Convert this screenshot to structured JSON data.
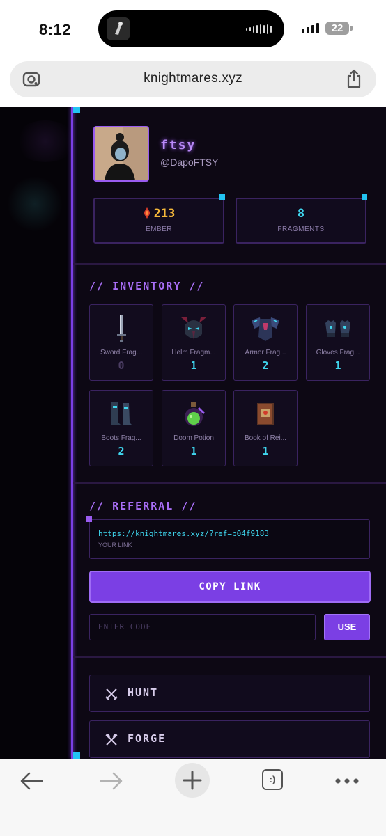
{
  "status_bar": {
    "time": "8:12",
    "battery": "22"
  },
  "browser": {
    "url": "knightmares.xyz"
  },
  "profile": {
    "username": "ftsy",
    "handle": "@DapoFTSY",
    "stats": [
      {
        "value": "213",
        "label": "EMBER",
        "color": "#f5b83a"
      },
      {
        "value": "8",
        "label": "FRAGMENTS",
        "color": "#3fd6ee"
      }
    ]
  },
  "inventory": {
    "title": "// INVENTORY //",
    "items": [
      {
        "name": "Sword Frag...",
        "count": "0",
        "icon": "sword-icon"
      },
      {
        "name": "Helm Fragm...",
        "count": "1",
        "icon": "helm-icon"
      },
      {
        "name": "Armor Frag...",
        "count": "2",
        "icon": "armor-icon"
      },
      {
        "name": "Gloves Frag...",
        "count": "1",
        "icon": "gloves-icon"
      },
      {
        "name": "Boots Frag...",
        "count": "2",
        "icon": "boots-icon"
      },
      {
        "name": "Doom Potion",
        "count": "1",
        "icon": "potion-icon"
      },
      {
        "name": "Book of Rei...",
        "count": "1",
        "icon": "book-icon"
      }
    ]
  },
  "referral": {
    "title": "// REFERRAL //",
    "link": "https://knightmares.xyz/?ref=b04f9183",
    "link_label": "YOUR LINK",
    "copy_button": "COPY LINK",
    "code_placeholder": "ENTER CODE",
    "use_button": "USE"
  },
  "actions": [
    {
      "label": "HUNT",
      "icon": "crossed-swords-icon"
    },
    {
      "label": "FORGE",
      "icon": "hammers-icon"
    }
  ],
  "colors": {
    "accent": "#7b3fe4",
    "cyan": "#3fd6ee",
    "background": "#0d0814"
  }
}
